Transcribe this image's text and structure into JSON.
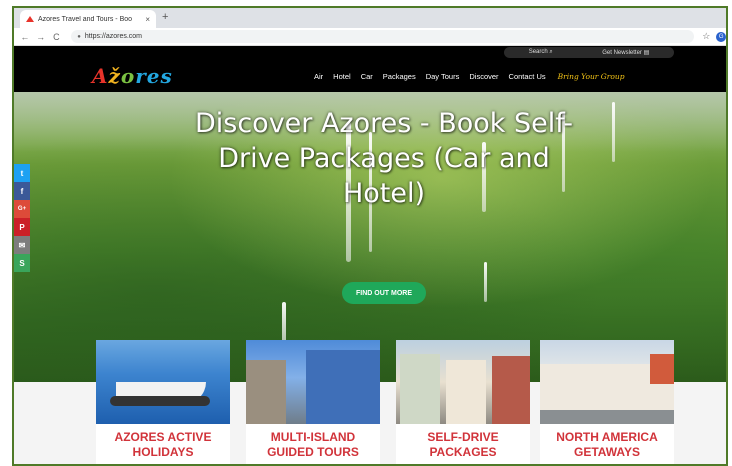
{
  "browser": {
    "tab_title": "Azores Travel and Tours - Boo",
    "tab_close": "×",
    "new_tab": "+",
    "url": "https://azores.com",
    "nav_back": "←",
    "nav_forward": "→",
    "nav_reload": "C",
    "star_icon": "☆",
    "profile_initial": "G"
  },
  "site": {
    "logo_parts": [
      "A",
      "ž",
      "o",
      "res"
    ],
    "topbar": {
      "search_label": "Search",
      "newsletter_label": "Get Newsletter"
    },
    "nav": [
      "Air",
      "Hotel",
      "Car",
      "Packages",
      "Day Tours",
      "Discover",
      "Contact Us"
    ],
    "nav_group": "Bring Your Group"
  },
  "hero": {
    "title": "Discover Azores - Book Self-Drive Packages (Car and Hotel)",
    "button": "FIND OUT MORE"
  },
  "social": [
    {
      "name": "twitter-icon",
      "glyph": "t",
      "color": "#1da1f2"
    },
    {
      "name": "facebook-icon",
      "glyph": "f",
      "color": "#3b5998"
    },
    {
      "name": "googleplus-icon",
      "glyph": "G+",
      "color": "#dd4b39"
    },
    {
      "name": "pinterest-icon",
      "glyph": "P",
      "color": "#cb2027"
    },
    {
      "name": "email-icon",
      "glyph": "✉",
      "color": "#7d7d7d"
    },
    {
      "name": "share-icon",
      "glyph": "S",
      "color": "#3aa55b"
    }
  ],
  "cards": [
    {
      "title": "AZORES ACTIVE HOLIDAYS"
    },
    {
      "title": "MULTI-ISLAND GUIDED TOURS"
    },
    {
      "title": "SELF-DRIVE PACKAGES"
    },
    {
      "title": "NORTH AMERICA GETAWAYS"
    }
  ]
}
